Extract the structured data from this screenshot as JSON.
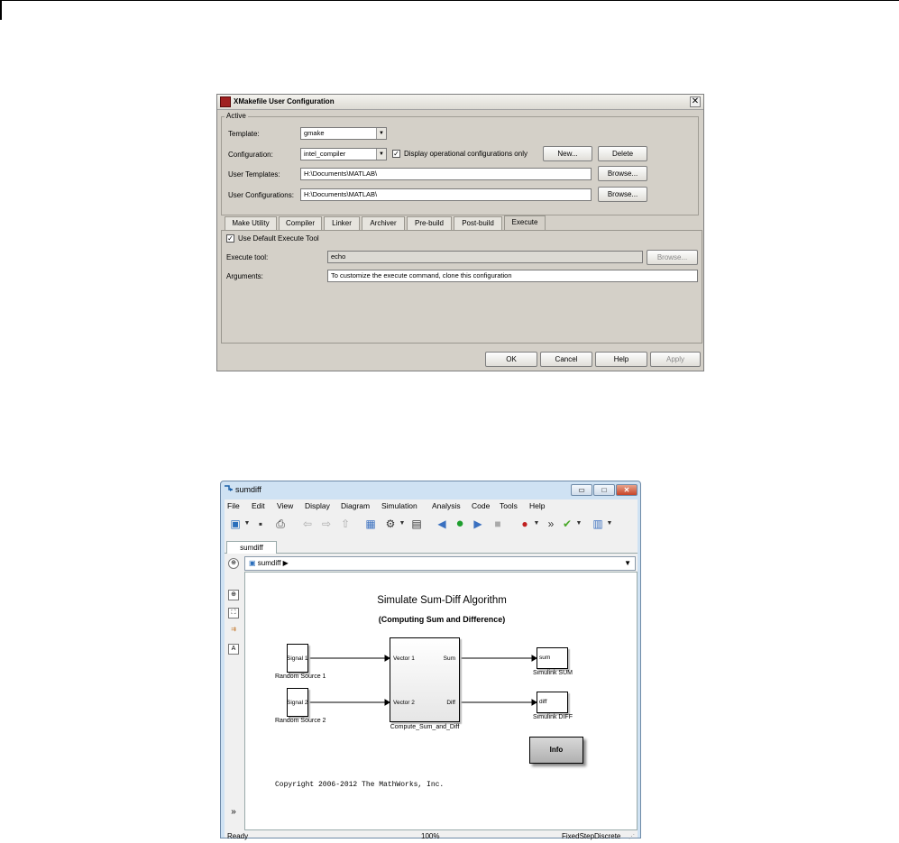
{
  "dialog": {
    "title": "XMakefile User Configuration",
    "close_glyph": "✕",
    "group_label": "Active",
    "template_label": "Template:",
    "template_value": "gmake",
    "configuration_label": "Configuration:",
    "configuration_value": "intel_compiler",
    "display_operational_label": "Display operational configurations only",
    "display_operational_checked": true,
    "new_button": "New...",
    "delete_button": "Delete",
    "user_templates_label": "User Templates:",
    "user_templates_value": "H:\\Documents\\MATLAB\\",
    "user_configurations_label": "User Configurations:",
    "user_configurations_value": "H:\\Documents\\MATLAB\\",
    "browse_button": "Browse...",
    "tabs": [
      "Make Utility",
      "Compiler",
      "Linker",
      "Archiver",
      "Pre-build",
      "Post-build",
      "Execute"
    ],
    "active_tab": "Execute",
    "use_default_label": "Use Default Execute Tool",
    "use_default_checked": true,
    "execute_tool_label": "Execute tool:",
    "execute_tool_value": "echo",
    "arguments_label": "Arguments:",
    "arguments_value": "To customize the execute command, clone this configuration",
    "ok_button": "OK",
    "cancel_button": "Cancel",
    "help_button": "Help",
    "apply_button": "Apply"
  },
  "simulink": {
    "title": "sumdiff",
    "window_buttons": {
      "minimize": "▭",
      "maximize": "□",
      "close": "✕"
    },
    "menus": [
      "File",
      "Edit",
      "View",
      "Display",
      "Diagram",
      "Simulation",
      "Analysis",
      "Code",
      "Tools",
      "Help"
    ],
    "toolbar_icons": [
      "new-model-icon",
      "save-icon",
      "print-icon",
      "back-icon",
      "forward-icon",
      "up-icon",
      "library-browser-icon",
      "settings-icon",
      "model-explorer-icon",
      "step-back-icon",
      "run-icon",
      "step-forward-icon",
      "stop-icon",
      "record-icon",
      "more-icon",
      "check-icon",
      "data-icon"
    ],
    "doc_tab": "sumdiff",
    "address": "sumdiff",
    "heading": "Simulate Sum-Diff Algorithm",
    "subheading": "(Computing Sum and Difference)",
    "blocks": {
      "signal1": "Signal 1",
      "signal1_caption": "Random Source 1",
      "signal2": "Signal 2",
      "signal2_caption": "Random Source 2",
      "compute_in1": "Vector 1",
      "compute_in2": "Vector 2",
      "compute_out1": "Sum",
      "compute_out2": "Diff",
      "compute_caption": "Compute_Sum_and_Diff",
      "sum_port": "sum",
      "sum_caption": "Simulink SUM",
      "diff_port": "diff",
      "diff_caption": "Simulink DIFF",
      "info": "Info"
    },
    "copyright": "Copyright 2006-2012 The MathWorks, Inc.",
    "status_ready": "Ready",
    "status_zoom": "100%",
    "status_solver": "FixedStepDiscrete",
    "side_more": "»"
  }
}
